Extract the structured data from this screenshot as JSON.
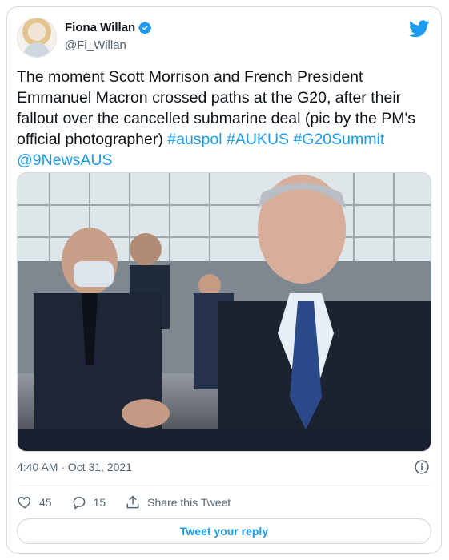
{
  "author": {
    "name": "Fiona Willan",
    "handle": "@Fi_Willan"
  },
  "tweet": {
    "text_plain": "The moment Scott Morrison and French President Emmanuel Macron crossed paths at the G20, after their fallout over the cancelled submarine deal (pic by the PM's official photographer)",
    "hashtags": [
      "#auspol",
      "#AUKUS",
      "#G20Summit"
    ],
    "mention": "@9NewsAUS",
    "timestamp": "4:40 AM · Oct 31, 2021"
  },
  "actions": {
    "likes": "45",
    "replies": "15",
    "share_label": "Share this Tweet",
    "reply_button_label": "Tweet your reply"
  },
  "colors": {
    "accent": "#1d9bf0",
    "text": "#0f1419",
    "muted": "#536471",
    "border": "#d6dadd"
  },
  "icons": [
    "verified-badge-icon",
    "twitter-bird-icon",
    "info-icon",
    "heart-icon",
    "reply-icon",
    "share-icon"
  ]
}
